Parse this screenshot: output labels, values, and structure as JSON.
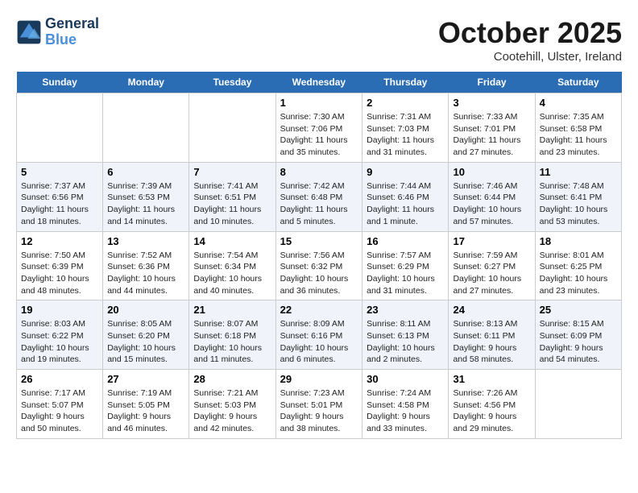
{
  "header": {
    "logo_line1": "General",
    "logo_line2": "Blue",
    "title": "October 2025",
    "subtitle": "Cootehill, Ulster, Ireland"
  },
  "days": [
    "Sunday",
    "Monday",
    "Tuesday",
    "Wednesday",
    "Thursday",
    "Friday",
    "Saturday"
  ],
  "weeks": [
    [
      {
        "date": "",
        "text": ""
      },
      {
        "date": "",
        "text": ""
      },
      {
        "date": "",
        "text": ""
      },
      {
        "date": "1",
        "text": "Sunrise: 7:30 AM\nSunset: 7:06 PM\nDaylight: 11 hours and 35 minutes."
      },
      {
        "date": "2",
        "text": "Sunrise: 7:31 AM\nSunset: 7:03 PM\nDaylight: 11 hours and 31 minutes."
      },
      {
        "date": "3",
        "text": "Sunrise: 7:33 AM\nSunset: 7:01 PM\nDaylight: 11 hours and 27 minutes."
      },
      {
        "date": "4",
        "text": "Sunrise: 7:35 AM\nSunset: 6:58 PM\nDaylight: 11 hours and 23 minutes."
      }
    ],
    [
      {
        "date": "5",
        "text": "Sunrise: 7:37 AM\nSunset: 6:56 PM\nDaylight: 11 hours and 18 minutes."
      },
      {
        "date": "6",
        "text": "Sunrise: 7:39 AM\nSunset: 6:53 PM\nDaylight: 11 hours and 14 minutes."
      },
      {
        "date": "7",
        "text": "Sunrise: 7:41 AM\nSunset: 6:51 PM\nDaylight: 11 hours and 10 minutes."
      },
      {
        "date": "8",
        "text": "Sunrise: 7:42 AM\nSunset: 6:48 PM\nDaylight: 11 hours and 5 minutes."
      },
      {
        "date": "9",
        "text": "Sunrise: 7:44 AM\nSunset: 6:46 PM\nDaylight: 11 hours and 1 minute."
      },
      {
        "date": "10",
        "text": "Sunrise: 7:46 AM\nSunset: 6:44 PM\nDaylight: 10 hours and 57 minutes."
      },
      {
        "date": "11",
        "text": "Sunrise: 7:48 AM\nSunset: 6:41 PM\nDaylight: 10 hours and 53 minutes."
      }
    ],
    [
      {
        "date": "12",
        "text": "Sunrise: 7:50 AM\nSunset: 6:39 PM\nDaylight: 10 hours and 48 minutes."
      },
      {
        "date": "13",
        "text": "Sunrise: 7:52 AM\nSunset: 6:36 PM\nDaylight: 10 hours and 44 minutes."
      },
      {
        "date": "14",
        "text": "Sunrise: 7:54 AM\nSunset: 6:34 PM\nDaylight: 10 hours and 40 minutes."
      },
      {
        "date": "15",
        "text": "Sunrise: 7:56 AM\nSunset: 6:32 PM\nDaylight: 10 hours and 36 minutes."
      },
      {
        "date": "16",
        "text": "Sunrise: 7:57 AM\nSunset: 6:29 PM\nDaylight: 10 hours and 31 minutes."
      },
      {
        "date": "17",
        "text": "Sunrise: 7:59 AM\nSunset: 6:27 PM\nDaylight: 10 hours and 27 minutes."
      },
      {
        "date": "18",
        "text": "Sunrise: 8:01 AM\nSunset: 6:25 PM\nDaylight: 10 hours and 23 minutes."
      }
    ],
    [
      {
        "date": "19",
        "text": "Sunrise: 8:03 AM\nSunset: 6:22 PM\nDaylight: 10 hours and 19 minutes."
      },
      {
        "date": "20",
        "text": "Sunrise: 8:05 AM\nSunset: 6:20 PM\nDaylight: 10 hours and 15 minutes."
      },
      {
        "date": "21",
        "text": "Sunrise: 8:07 AM\nSunset: 6:18 PM\nDaylight: 10 hours and 11 minutes."
      },
      {
        "date": "22",
        "text": "Sunrise: 8:09 AM\nSunset: 6:16 PM\nDaylight: 10 hours and 6 minutes."
      },
      {
        "date": "23",
        "text": "Sunrise: 8:11 AM\nSunset: 6:13 PM\nDaylight: 10 hours and 2 minutes."
      },
      {
        "date": "24",
        "text": "Sunrise: 8:13 AM\nSunset: 6:11 PM\nDaylight: 9 hours and 58 minutes."
      },
      {
        "date": "25",
        "text": "Sunrise: 8:15 AM\nSunset: 6:09 PM\nDaylight: 9 hours and 54 minutes."
      }
    ],
    [
      {
        "date": "26",
        "text": "Sunrise: 7:17 AM\nSunset: 5:07 PM\nDaylight: 9 hours and 50 minutes."
      },
      {
        "date": "27",
        "text": "Sunrise: 7:19 AM\nSunset: 5:05 PM\nDaylight: 9 hours and 46 minutes."
      },
      {
        "date": "28",
        "text": "Sunrise: 7:21 AM\nSunset: 5:03 PM\nDaylight: 9 hours and 42 minutes."
      },
      {
        "date": "29",
        "text": "Sunrise: 7:23 AM\nSunset: 5:01 PM\nDaylight: 9 hours and 38 minutes."
      },
      {
        "date": "30",
        "text": "Sunrise: 7:24 AM\nSunset: 4:58 PM\nDaylight: 9 hours and 33 minutes."
      },
      {
        "date": "31",
        "text": "Sunrise: 7:26 AM\nSunset: 4:56 PM\nDaylight: 9 hours and 29 minutes."
      },
      {
        "date": "",
        "text": ""
      }
    ]
  ]
}
